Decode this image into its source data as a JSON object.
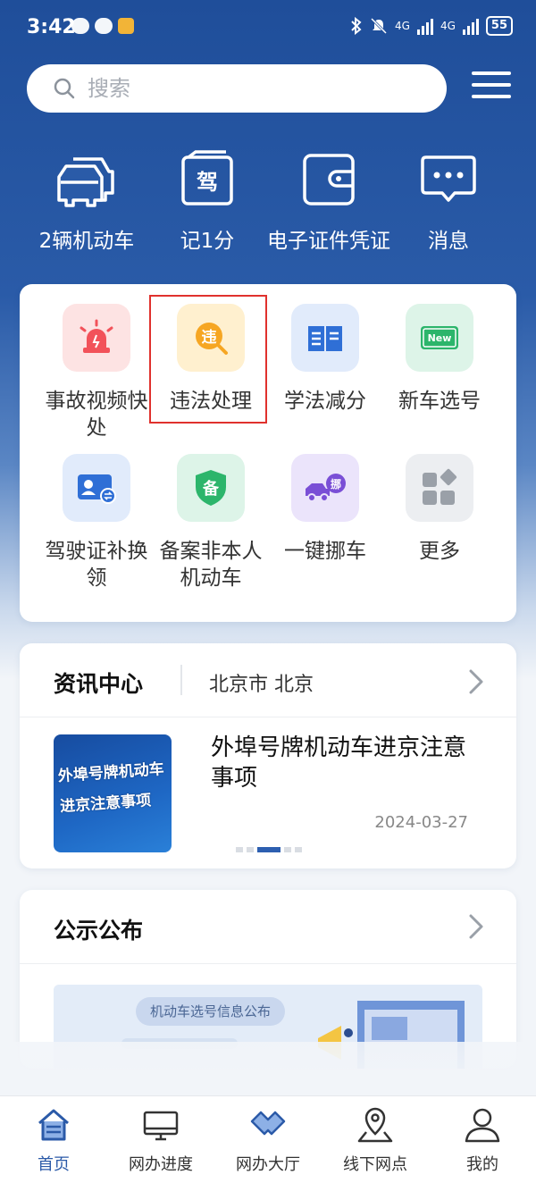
{
  "status_bar": {
    "time": "3:42",
    "network": "4G",
    "battery": "55"
  },
  "search": {
    "placeholder": "搜索"
  },
  "quick": [
    {
      "label": "2辆机动车",
      "icon": "car-icon"
    },
    {
      "label": "记1分",
      "icon": "license-icon",
      "glyph": "驾"
    },
    {
      "label": "电子证件凭证",
      "icon": "wallet-icon"
    },
    {
      "label": "消息",
      "icon": "message-icon"
    }
  ],
  "services": [
    {
      "label": "事故视频快处",
      "icon": "alarm-light-icon",
      "bg": "#fde3e3"
    },
    {
      "label": "违法处理",
      "icon": "violation-search-icon",
      "glyph": "违",
      "bg": "#fff0cf"
    },
    {
      "label": "学法减分",
      "icon": "book-icon",
      "bg": "#e1ebfb"
    },
    {
      "label": "新车选号",
      "icon": "new-plate-icon",
      "glyph": "New",
      "bg": "#ddf4e8"
    },
    {
      "label": "驾驶证补换领",
      "icon": "id-card-swap-icon",
      "bg": "#e1ebfb"
    },
    {
      "label": "备案非本人机动车",
      "icon": "shield-icon",
      "glyph": "备",
      "bg": "#ddf4e8"
    },
    {
      "label": "一键挪车",
      "icon": "tow-truck-icon",
      "glyph": "挪",
      "bg": "#ebe4fb"
    },
    {
      "label": "更多",
      "icon": "more-grid-icon",
      "bg": "#eceef1"
    }
  ],
  "news": {
    "title": "资讯中心",
    "city": "北京市 北京",
    "item": {
      "title": "外埠号牌机动车进京注意事项",
      "date": "2024-03-27",
      "thumb_text": "外埠号牌机动车进京注意事项"
    }
  },
  "notice": {
    "title": "公示公布",
    "banner_pill": "机动车选号信息公布"
  },
  "tabs": [
    {
      "label": "首页",
      "icon": "home-icon",
      "active": true
    },
    {
      "label": "网办进度",
      "icon": "monitor-icon",
      "active": false
    },
    {
      "label": "网办大厅",
      "icon": "hall-icon",
      "active": false
    },
    {
      "label": "线下网点",
      "icon": "map-pin-icon",
      "active": false
    },
    {
      "label": "我的",
      "icon": "user-icon",
      "active": false
    }
  ],
  "colors": {
    "brand": "#2a5ba8",
    "highlight": "#e0312d"
  }
}
